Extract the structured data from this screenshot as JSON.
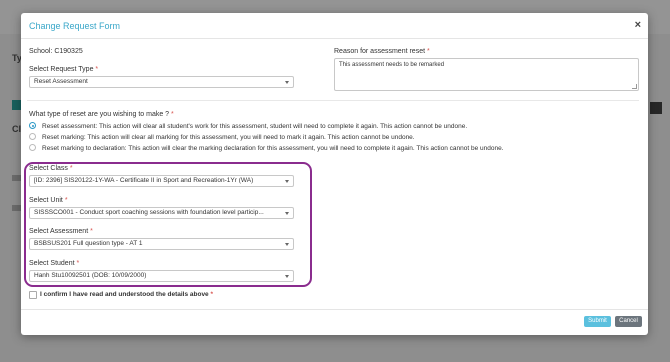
{
  "modal": {
    "title": "Change Request Form",
    "close_glyph": "×",
    "school_label": "School:",
    "school_code": "C190325",
    "request_type": {
      "label": "Select Request Type",
      "required_mark": "*",
      "value": "Reset Assessment"
    },
    "reason": {
      "label": "Reason for assessment reset",
      "required_mark": "*",
      "value": "This assessment needs to be remarked"
    },
    "reset_question": {
      "label": "What type of reset are you wishing to make ?",
      "required_mark": "*"
    },
    "reset_options": [
      {
        "label": "Reset assessment: This action will clear all student's work for this assessment, student will need to complete it again. This action cannot be undone.",
        "selected": true
      },
      {
        "label": "Reset marking: This action will clear all marking for this assessment, you will need to mark it again. This action cannot be undone.",
        "selected": false
      },
      {
        "label": "Reset marking to declaration: This action will clear the marking declaration for this assessment, you will need to complete it again. This action cannot be undone.",
        "selected": false
      }
    ],
    "class": {
      "label": "Select Class",
      "required_mark": "*",
      "value": "[ID: 2396] SIS20122-1Y-WA - Certificate II in Sport and Recreation-1Yr (WA)"
    },
    "unit": {
      "label": "Select Unit",
      "required_mark": "*",
      "value": "SISSSCO001 - Conduct sport coaching sessions with foundation level particip..."
    },
    "assessment": {
      "label": "Select Assessment",
      "required_mark": "*",
      "value": "BSBSUS201 Full question type - AT 1"
    },
    "student": {
      "label": "Select Student",
      "required_mark": "*",
      "value": "Hanh Stu10092501 (DOB: 10/09/2000)"
    },
    "confirm": {
      "label": "I confirm I have read and understood the details above",
      "required_mark": "*",
      "checked": false
    },
    "buttons": {
      "submit": "Submit",
      "cancel": "Cancel"
    }
  },
  "background": {
    "fragments": [
      "Ty",
      "Cl"
    ]
  },
  "colors": {
    "title": "#3aa7c9",
    "required": "#d9534f",
    "highlight_border": "#8a2c8e",
    "submit": "#5bc0de",
    "cancel": "#6c757d",
    "radio_selected": "#2c98c6"
  }
}
